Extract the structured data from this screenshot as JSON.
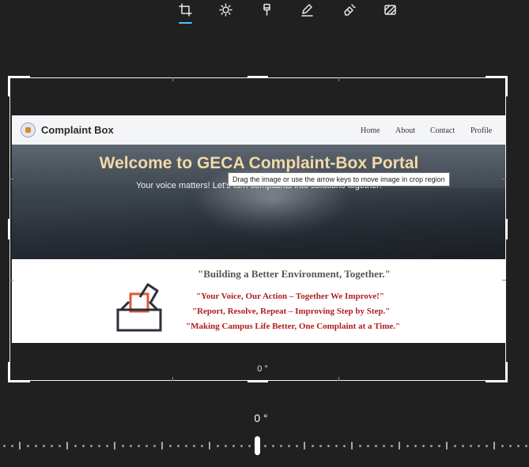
{
  "toolbar": {
    "tools": [
      {
        "name": "crop-icon",
        "label": "Crop",
        "active": true
      },
      {
        "name": "brightness-icon",
        "label": "Adjustment"
      },
      {
        "name": "filter-brush-icon",
        "label": "Filter"
      },
      {
        "name": "draw-pen-icon",
        "label": "Markup"
      },
      {
        "name": "erase-icon",
        "label": "Erase"
      },
      {
        "name": "background-blur-icon",
        "label": "Background"
      }
    ],
    "accent": "#4cc2ff"
  },
  "image": {
    "brand": "Complaint Box",
    "nav": [
      "Home",
      "About",
      "Contact",
      "Profile"
    ],
    "hero_title": "Welcome to GECA Complaint-Box Portal",
    "hero_subtitle": "Your voice matters! Let's turn complaints into solutions together!",
    "tooltip": "Drag the image or use the arrow keys to move image in crop region",
    "quote_main": "\"Building a Better Environment, Together.\"",
    "quotes": [
      "\"Your Voice, Our Action – Together We Improve!\"",
      "\"Report, Resolve, Repeat – Improving Step by Step.\"",
      "\"Making Campus Life Better, One Complaint at a Time.\""
    ],
    "title_color": "#f3d9a7",
    "quote_color": "#b01e1e"
  },
  "rotation": {
    "inner_label": "0 °",
    "main_label": "0 °",
    "value_degrees": 0
  }
}
